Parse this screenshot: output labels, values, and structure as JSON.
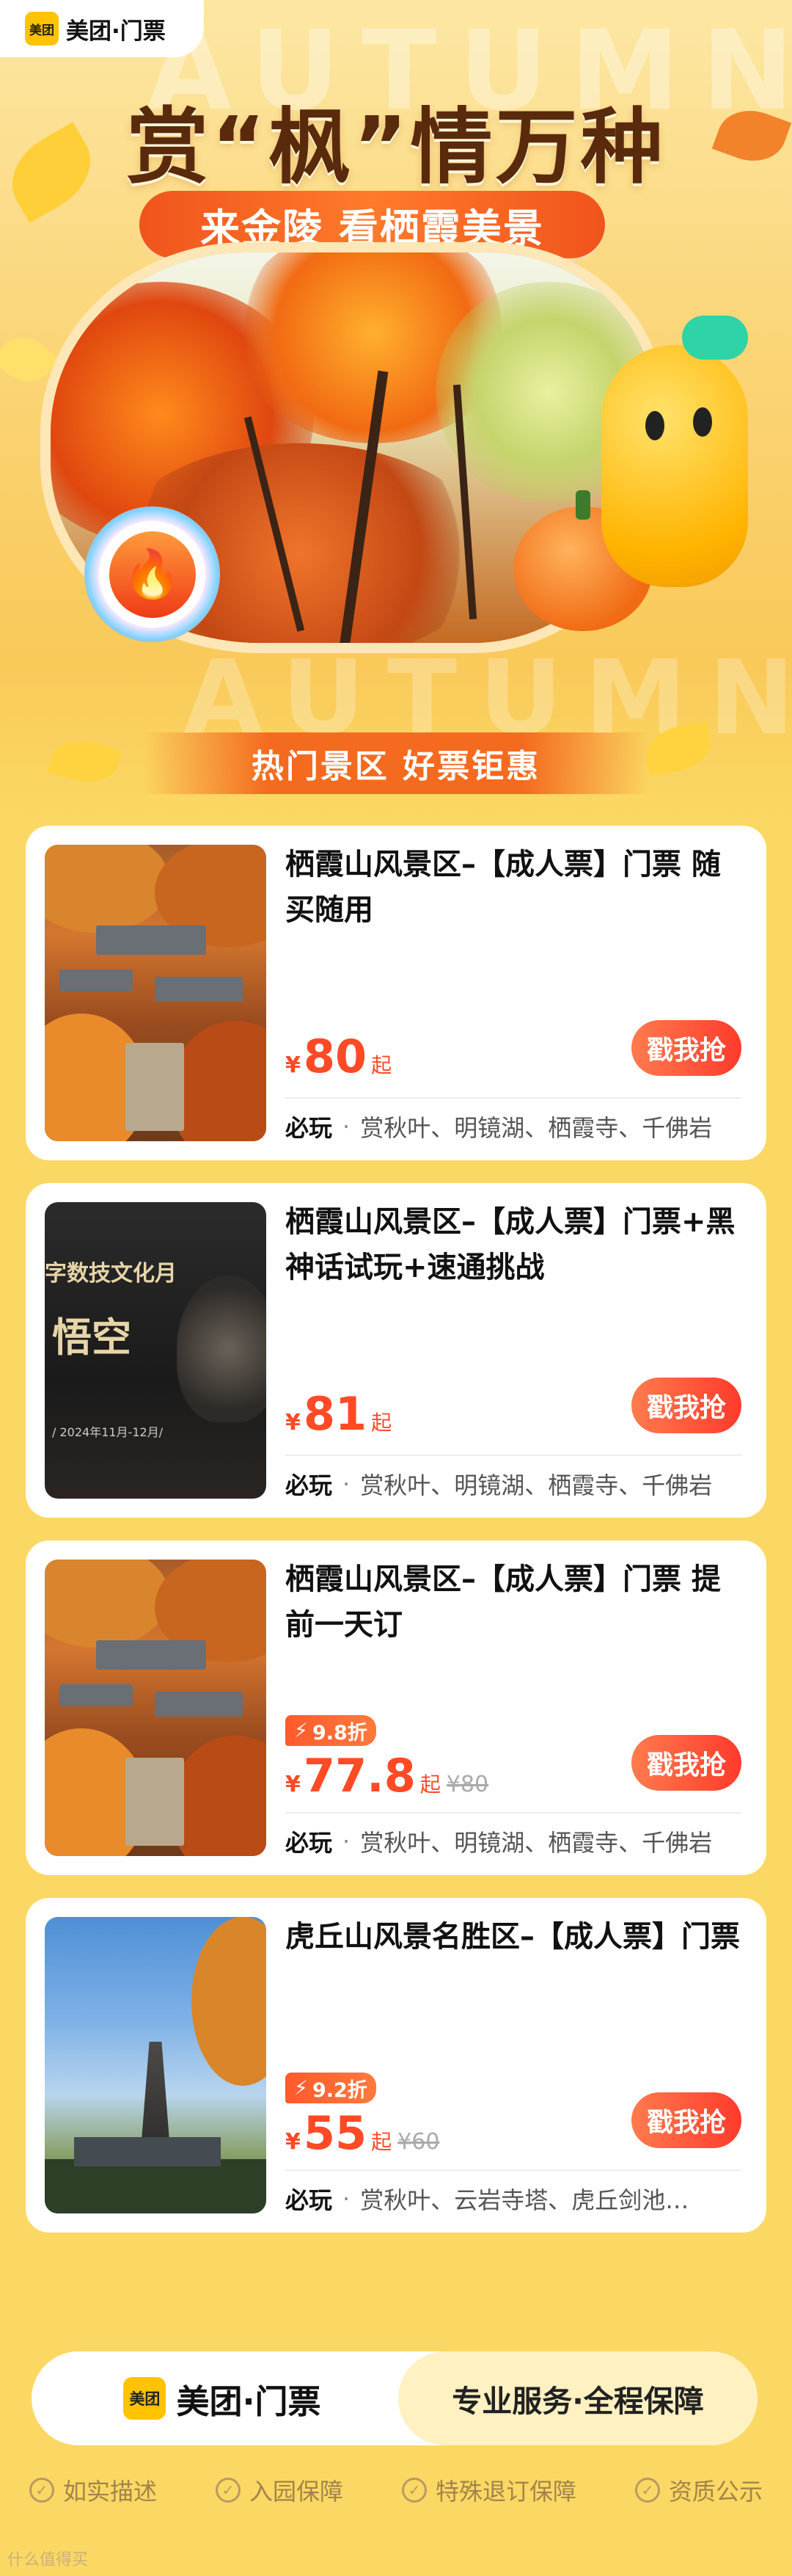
{
  "header": {
    "logo_badge": "美团",
    "logo_text": "美团·门票"
  },
  "hero": {
    "bg_word": "AUTUMN",
    "title": "赏“枫”情万种",
    "subtitle": "来金陵 看栖霞美景",
    "banner": "热门景区 好票钜惠"
  },
  "products": [
    {
      "name": "栖霞山风景区–【成人票】门票 随买随用",
      "currency": "¥",
      "price": "80",
      "suffix": "起",
      "discount": "",
      "original_price": "",
      "button": "戳我抢",
      "tag_label": "必玩",
      "tag_sep": "·",
      "tags": "赏秋叶、明镜湖、栖霞寺、千佛岩"
    },
    {
      "name": "栖霞山风景区–【成人票】门票+黑神话试玩+速通挑战",
      "currency": "¥",
      "price": "81",
      "suffix": "起",
      "discount": "",
      "original_price": "",
      "button": "戳我抢",
      "tag_label": "必玩",
      "tag_sep": "·",
      "tags": "赏秋叶、明镜湖、栖霞寺、千佛岩",
      "thumb_text1": "字数技文化月",
      "thumb_text2": "悟空",
      "thumb_text3": "/ 2024年11月-12月/"
    },
    {
      "name": "栖霞山风景区–【成人票】门票 提前一天订",
      "currency": "¥",
      "price": "77.8",
      "suffix": "起",
      "discount": "9.8折",
      "original_price": "¥80",
      "button": "戳我抢",
      "tag_label": "必玩",
      "tag_sep": "·",
      "tags": "赏秋叶、明镜湖、栖霞寺、千佛岩"
    },
    {
      "name": "虎丘山风景名胜区–【成人票】门票",
      "currency": "¥",
      "price": "55",
      "suffix": "起",
      "discount": "9.2折",
      "original_price": "¥60",
      "button": "戳我抢",
      "tag_label": "必玩",
      "tag_sep": "·",
      "tags": "赏秋叶、云岩寺塔、虎丘剑池…"
    }
  ],
  "footer": {
    "badge": "美团",
    "brand": "美团·门票",
    "slogan": "专业服务·全程保障",
    "guarantees": [
      "如实描述",
      "入园保障",
      "特殊退订保障",
      "资质公示"
    ]
  },
  "watermark": "什么值得买",
  "colors": {
    "accent": "#ff4a26",
    "brand_yellow": "#ffc300",
    "page_bg": "#fbd863"
  }
}
